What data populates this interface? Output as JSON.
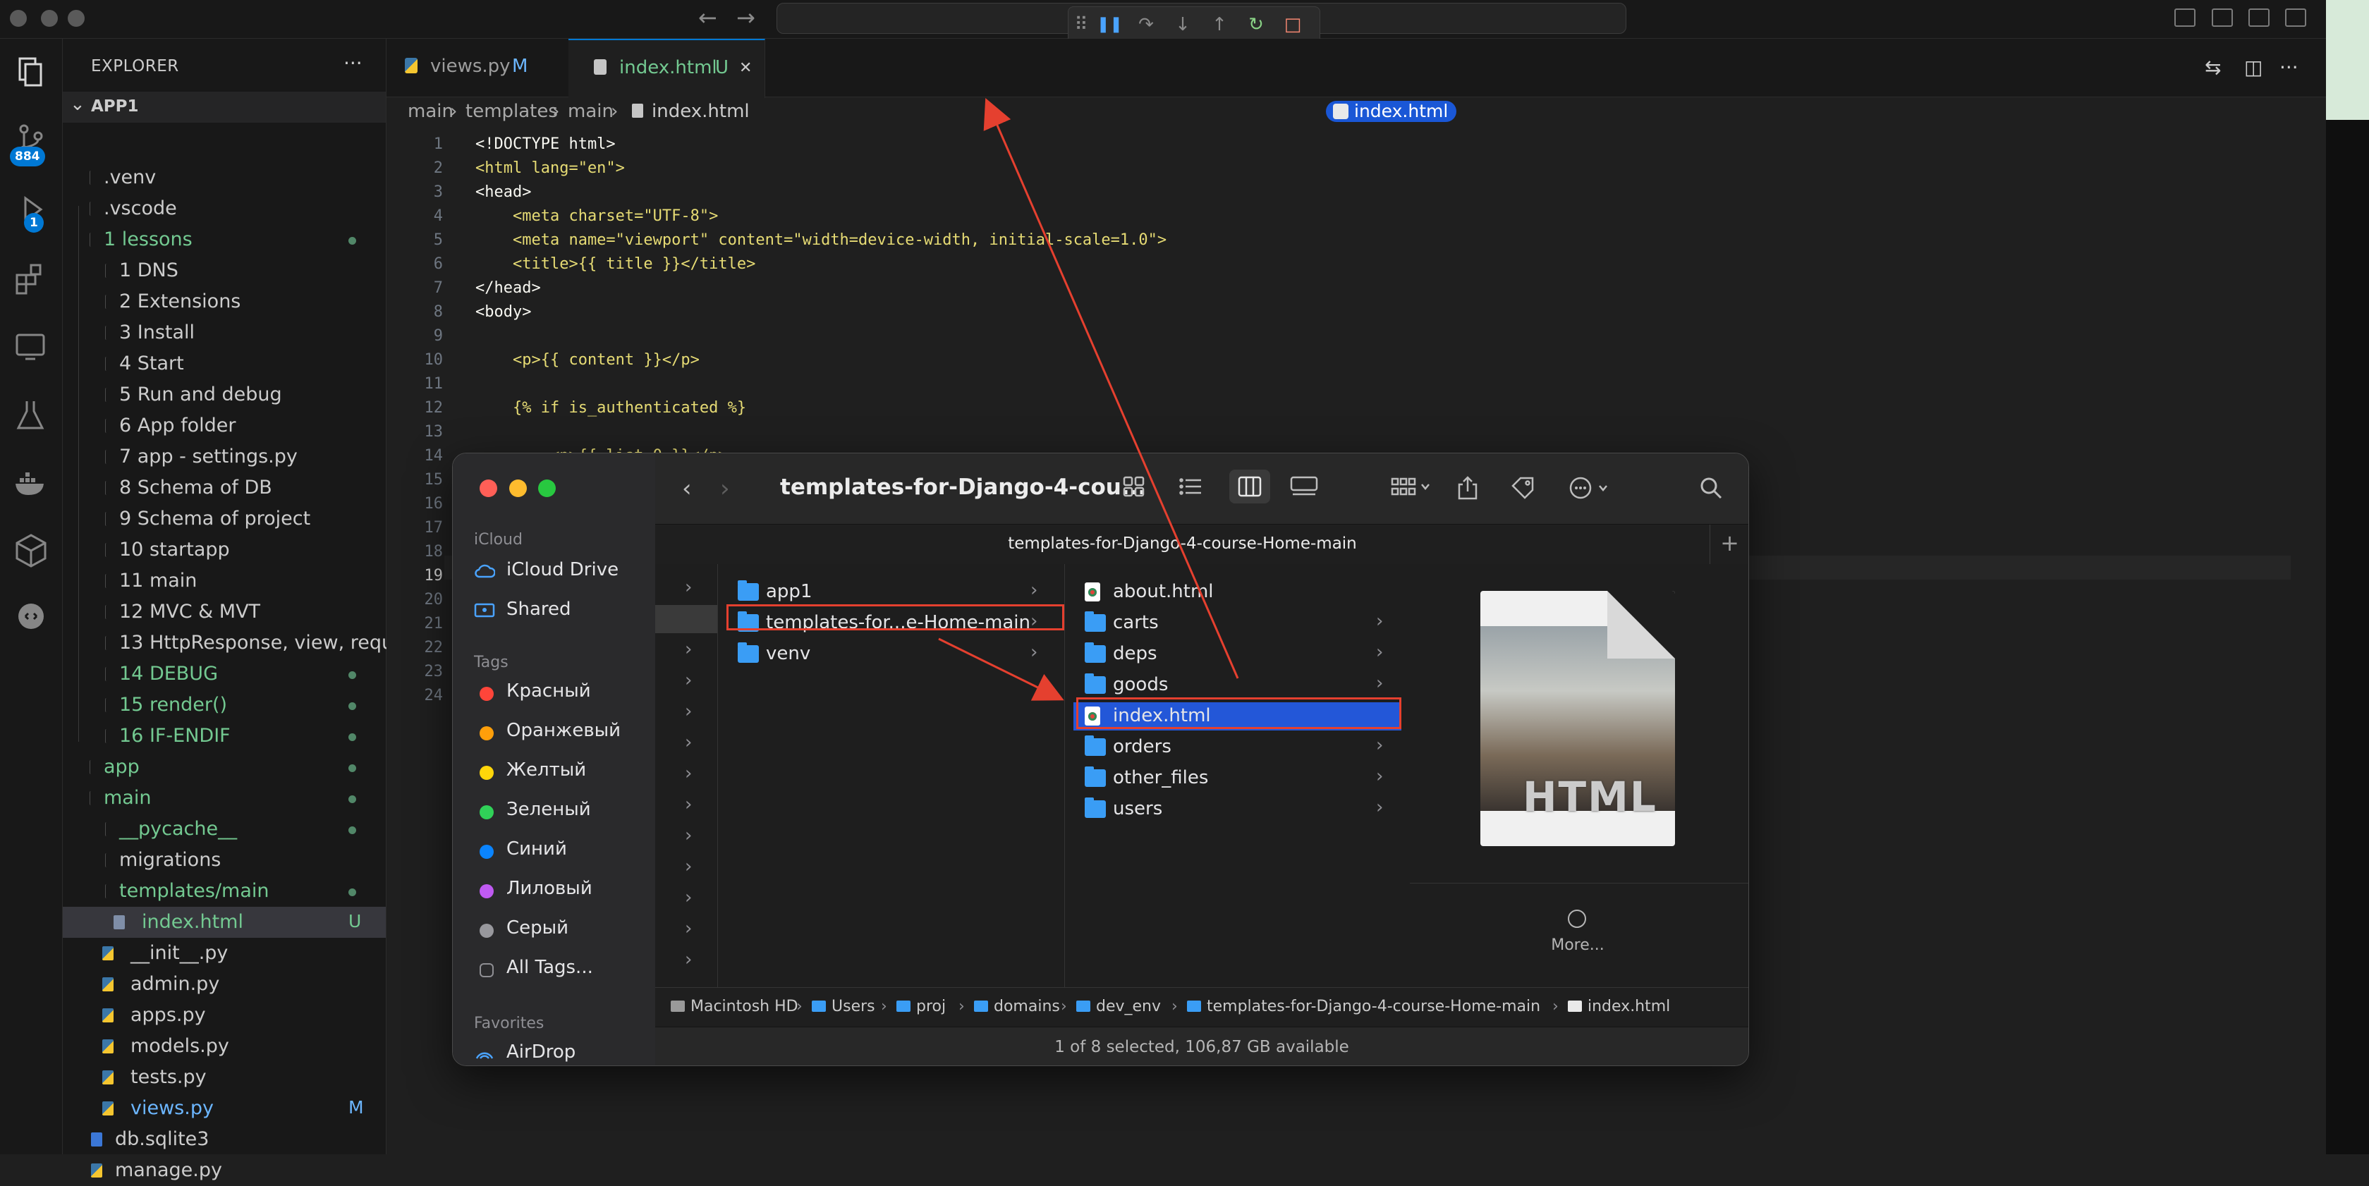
{
  "titlebar": {
    "nav_back": "←",
    "nav_forward": "→"
  },
  "debug_toolbar": {
    "grip": "⠿",
    "pause": "❚❚",
    "step_over": "↷",
    "step_into": "↓",
    "step_out": "↑",
    "restart": "↻",
    "stop": "□"
  },
  "activity": {
    "source_control_badge": "884",
    "run_debug_badge": "1"
  },
  "explorer": {
    "header": "EXPLORER",
    "more": "···",
    "root": "APP1",
    "items": [
      {
        "label": ".venv",
        "kind": "folder",
        "depth": 0,
        "color": "#cccccc",
        "badge": "",
        "dot": false
      },
      {
        "label": ".vscode",
        "kind": "folder",
        "depth": 0,
        "color": "#cccccc",
        "badge": "",
        "dot": false
      },
      {
        "label": "1 lessons",
        "kind": "folder",
        "depth": 0,
        "color": "#73c991",
        "badge": "",
        "dot": true
      },
      {
        "label": "1 DNS",
        "kind": "folder",
        "depth": 1,
        "color": "#cccccc",
        "badge": "",
        "dot": false
      },
      {
        "label": "2 Extensions",
        "kind": "folder",
        "depth": 1,
        "color": "#cccccc",
        "badge": "",
        "dot": false
      },
      {
        "label": "3 Install",
        "kind": "folder",
        "depth": 1,
        "color": "#cccccc",
        "badge": "",
        "dot": false
      },
      {
        "label": "4 Start",
        "kind": "folder",
        "depth": 1,
        "color": "#cccccc",
        "badge": "",
        "dot": false
      },
      {
        "label": "5 Run and debug",
        "kind": "folder",
        "depth": 1,
        "color": "#cccccc",
        "badge": "",
        "dot": false
      },
      {
        "label": "6 App folder",
        "kind": "folder",
        "depth": 1,
        "color": "#cccccc",
        "badge": "",
        "dot": false
      },
      {
        "label": "7 app  -  settings.py",
        "kind": "folder",
        "depth": 1,
        "color": "#cccccc",
        "badge": "",
        "dot": false
      },
      {
        "label": "8 Schema of DB",
        "kind": "folder",
        "depth": 1,
        "color": "#cccccc",
        "badge": "",
        "dot": false
      },
      {
        "label": "9 Schema of project",
        "kind": "folder",
        "depth": 1,
        "color": "#cccccc",
        "badge": "",
        "dot": false
      },
      {
        "label": "10 startapp",
        "kind": "folder",
        "depth": 1,
        "color": "#cccccc",
        "badge": "",
        "dot": false
      },
      {
        "label": "11 main",
        "kind": "folder",
        "depth": 1,
        "color": "#cccccc",
        "badge": "",
        "dot": false
      },
      {
        "label": "12 MVC & MVT",
        "kind": "folder",
        "depth": 1,
        "color": "#cccccc",
        "badge": "",
        "dot": false
      },
      {
        "label": "13 HttpResponse, view, requ...",
        "kind": "folder",
        "depth": 1,
        "color": "#cccccc",
        "badge": "",
        "dot": false
      },
      {
        "label": "14 DEBUG",
        "kind": "folder",
        "depth": 1,
        "color": "#73c991",
        "badge": "",
        "dot": true
      },
      {
        "label": "15 render()",
        "kind": "folder",
        "depth": 1,
        "color": "#73c991",
        "badge": "",
        "dot": true
      },
      {
        "label": "16 IF-ENDIF",
        "kind": "folder",
        "depth": 1,
        "color": "#73c991",
        "badge": "",
        "dot": true
      },
      {
        "label": "app",
        "kind": "folder",
        "depth": 0,
        "color": "#73c991",
        "badge": "",
        "dot": true
      },
      {
        "label": "main",
        "kind": "folder",
        "depth": 0,
        "color": "#73c991",
        "badge": "",
        "dot": true
      },
      {
        "label": "__pycache__",
        "kind": "folder",
        "depth": 1,
        "color": "#73c991",
        "badge": "",
        "dot": true
      },
      {
        "label": "migrations",
        "kind": "folder",
        "depth": 1,
        "color": "#cccccc",
        "badge": "",
        "dot": false
      },
      {
        "label": "templates/main",
        "kind": "folder",
        "depth": 1,
        "color": "#73c991",
        "badge": "",
        "dot": true
      },
      {
        "label": "index.html",
        "kind": "html",
        "depth": 2,
        "color": "#73c991",
        "badge": "U",
        "dot": false,
        "selected": true
      },
      {
        "label": "__init__.py",
        "kind": "py",
        "depth": 1,
        "color": "#cccccc",
        "badge": "",
        "dot": false
      },
      {
        "label": "admin.py",
        "kind": "py",
        "depth": 1,
        "color": "#cccccc",
        "badge": "",
        "dot": false
      },
      {
        "label": "apps.py",
        "kind": "py",
        "depth": 1,
        "color": "#cccccc",
        "badge": "",
        "dot": false
      },
      {
        "label": "models.py",
        "kind": "py",
        "depth": 1,
        "color": "#cccccc",
        "badge": "",
        "dot": false
      },
      {
        "label": "tests.py",
        "kind": "py",
        "depth": 1,
        "color": "#cccccc",
        "badge": "",
        "dot": false
      },
      {
        "label": "views.py",
        "kind": "py",
        "depth": 1,
        "color": "#6cb6ff",
        "badge": "M",
        "dot": false
      },
      {
        "label": "db.sqlite3",
        "kind": "db",
        "depth": 0,
        "color": "#cccccc",
        "badge": "",
        "dot": false
      },
      {
        "label": "manage.py",
        "kind": "py",
        "depth": 0,
        "color": "#cccccc",
        "badge": "",
        "dot": false
      }
    ]
  },
  "tabs": [
    {
      "label": "views.py",
      "badge": "M",
      "active": false
    },
    {
      "label": "index.html",
      "badge": "U",
      "active": true,
      "close": "✕"
    }
  ],
  "breadcrumb": [
    "main",
    "templates",
    "main",
    "index.html"
  ],
  "breadcrumb_sep": "›",
  "drag_pill": "index.html",
  "code": {
    "line_numbers": [
      "1",
      "2",
      "3",
      "4",
      "5",
      "6",
      "7",
      "8",
      "9",
      "10",
      "11",
      "12",
      "13",
      "14",
      "15",
      "16",
      "17",
      "18",
      "19",
      "20",
      "21",
      "22",
      "23",
      "24"
    ],
    "lines": [
      "<!DOCTYPE html>",
      "<html lang=\"en\">",
      "<head>",
      "    <meta charset=\"UTF-8\">",
      "    <meta name=\"viewport\" content=\"width=device-width, initial-scale=1.0\">",
      "    <title>{{ title }}</title>",
      "</head>",
      "<body>",
      "",
      "    <p>{{ content }}</p>",
      "",
      "    {% if is_authenticated %}",
      "",
      "        <p>{{ list.0 }}</p>"
    ]
  },
  "finder": {
    "title": "templates-for-Django-4-cou...",
    "path_tab": "templates-for-Django-4-course-Home-main",
    "sidebar": {
      "icloud_header": "iCloud",
      "icloud": [
        {
          "label": "iCloud Drive",
          "icon": "cloud-icon"
        },
        {
          "label": "Shared",
          "icon": "shared-folder-icon"
        }
      ],
      "tags_header": "Tags",
      "tags": [
        {
          "label": "Красный",
          "color": "#ff453a"
        },
        {
          "label": "Оранжевый",
          "color": "#ff9f0a"
        },
        {
          "label": "Желтый",
          "color": "#ffd60a"
        },
        {
          "label": "Зеленый",
          "color": "#30d158"
        },
        {
          "label": "Синий",
          "color": "#0a84ff"
        },
        {
          "label": "Лиловый",
          "color": "#bf5af2"
        },
        {
          "label": "Серый",
          "color": "#98989d"
        },
        {
          "label": "All Tags...",
          "color": ""
        }
      ],
      "favorites_header": "Favorites",
      "favorites": [
        {
          "label": "AirDrop",
          "icon": "airdrop-icon"
        }
      ]
    },
    "column2": [
      {
        "label": "app1",
        "type": "folder",
        "chevron": true
      },
      {
        "label": "templates-for...e-Home-main",
        "type": "folder",
        "chevron": true,
        "selected": true
      },
      {
        "label": "venv",
        "type": "folder",
        "chevron": true
      }
    ],
    "column3": [
      {
        "label": "about.html",
        "type": "html",
        "chevron": false
      },
      {
        "label": "carts",
        "type": "folder",
        "chevron": true
      },
      {
        "label": "deps",
        "type": "folder",
        "chevron": true
      },
      {
        "label": "goods",
        "type": "folder",
        "chevron": true
      },
      {
        "label": "index.html",
        "type": "html",
        "chevron": false,
        "selected": true
      },
      {
        "label": "orders",
        "type": "folder",
        "chevron": true
      },
      {
        "label": "other_files",
        "type": "folder",
        "chevron": true
      },
      {
        "label": "users",
        "type": "folder",
        "chevron": true
      }
    ],
    "preview": {
      "thumbnail_text": "HTML",
      "more": "More..."
    },
    "pathbar": [
      "Macintosh HD",
      "Users",
      "proj",
      "domains",
      "dev_env",
      "templates-for-Django-4-course-Home-main",
      "index.html"
    ],
    "status": "1 of 8 selected, 106,87 GB available"
  },
  "colors": {
    "accent": "#0078d4",
    "annotation": "#e5402f",
    "git_added": "#73c991",
    "git_modified": "#6cb6ff",
    "finder_selection": "#2357d8"
  }
}
